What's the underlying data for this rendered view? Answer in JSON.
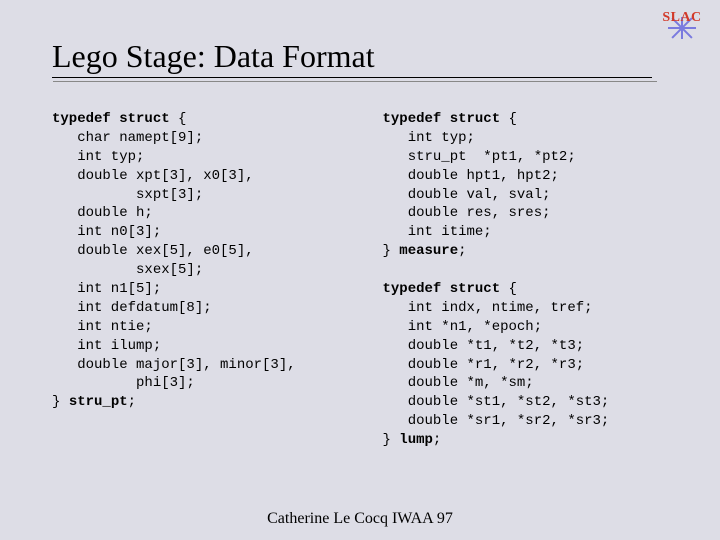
{
  "logo": {
    "label": "SLAC"
  },
  "title": "Lego Stage: Data Format",
  "code": {
    "left": {
      "open_kw": "typedef struct",
      "open_brace": " {",
      "lines": [
        "   char namept[9];",
        "   int typ;",
        "   double xpt[3], x0[3],",
        "          sxpt[3];",
        "   double h;",
        "   int n0[3];",
        "   double xex[5], e0[5],",
        "          sxex[5];",
        "   int n1[5];",
        "   int defdatum[8];",
        "   int ntie;",
        "   int ilump;",
        "   double major[3], minor[3],",
        "          phi[3];"
      ],
      "close_prefix": "} ",
      "close_kw": "stru_pt",
      "close_suffix": ";"
    },
    "right_top": {
      "open_kw": "typedef struct",
      "open_brace": " {",
      "lines": [
        "   int typ;",
        "   stru_pt  *pt1, *pt2;",
        "   double hpt1, hpt2;",
        "   double val, sval;",
        "   double res, sres;",
        "   int itime;"
      ],
      "close_prefix": "} ",
      "close_kw": "measure",
      "close_suffix": ";"
    },
    "right_bottom": {
      "open_kw": "typedef struct",
      "open_brace": " {",
      "lines": [
        "   int indx, ntime, tref;",
        "   int *n1, *epoch;",
        "   double *t1, *t2, *t3;",
        "   double *r1, *r2, *r3;",
        "   double *m, *sm;",
        "   double *st1, *st2, *st3;",
        "   double *sr1, *sr2, *sr3;"
      ],
      "close_prefix": "} ",
      "close_kw": "lump",
      "close_suffix": ";"
    }
  },
  "footer": "Catherine Le Cocq  IWAA 97"
}
